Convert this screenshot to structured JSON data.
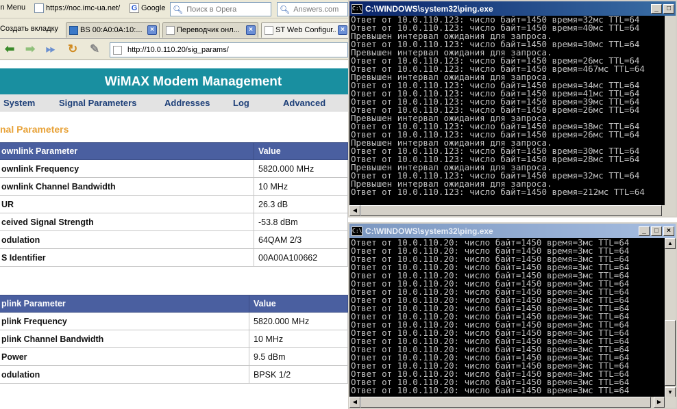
{
  "browser": {
    "bookmarks": [
      {
        "label": "in Menu",
        "icon": "page-icon"
      },
      {
        "label": "https://noc.imc-ua.net/",
        "icon": "page-icon"
      },
      {
        "label": "Google",
        "icon": "google-icon"
      }
    ],
    "search_opera": "Поиск в Opera",
    "search_answers": "Answers.com",
    "new_tab": "Создать вкладку",
    "tabs": [
      {
        "label": "BS 00:A0:0A:10:..."
      },
      {
        "label": "Переводчик онл..."
      },
      {
        "label": "ST Web Configur..."
      }
    ],
    "url": "http://10.0.110.20/sig_params/"
  },
  "page": {
    "banner": "WiMAX Modem Management",
    "menu": [
      "System",
      "Signal Parameters",
      "Addresses",
      "Log",
      "Advanced"
    ],
    "section_title": "nal Parameters",
    "downlink": {
      "headers": [
        "ownlink Parameter",
        "Value"
      ],
      "rows": [
        [
          "ownlink Frequency",
          "5820.000 MHz"
        ],
        [
          "ownlink Channel Bandwidth",
          "10 MHz"
        ],
        [
          "UR",
          "26.3 dB"
        ],
        [
          "ceived Signal Strength",
          "-53.8 dBm"
        ],
        [
          "odulation",
          "64QAM 2/3"
        ],
        [
          "S Identifier",
          "00A00A100662"
        ]
      ]
    },
    "uplink": {
      "headers": [
        "plink Parameter",
        "Value"
      ],
      "rows": [
        [
          "plink Frequency",
          "5820.000 MHz"
        ],
        [
          "plink Channel Bandwidth",
          "10 MHz"
        ],
        [
          "Power",
          "9.5 dBm"
        ],
        [
          "odulation",
          "BPSK 1/2"
        ]
      ]
    }
  },
  "console1": {
    "title": "C:\\WINDOWS\\system32\\ping.exe",
    "lines": [
      "Ответ от 10.0.110.123: число байт=1450 время=32мс TTL=64",
      "Ответ от 10.0.110.123: число байт=1450 время=40мс TTL=64",
      "Превышен интервал ожидания для запроса.",
      "Ответ от 10.0.110.123: число байт=1450 время=30мс TTL=64",
      "Превышен интервал ожидания для запроса.",
      "Ответ от 10.0.110.123: число байт=1450 время=26мс TTL=64",
      "Ответ от 10.0.110.123: число байт=1450 время=467мс TTL=64",
      "Превышен интервал ожидания для запроса.",
      "Ответ от 10.0.110.123: число байт=1450 время=34мс TTL=64",
      "Ответ от 10.0.110.123: число байт=1450 время=41мс TTL=64",
      "Ответ от 10.0.110.123: число байт=1450 время=39мс TTL=64",
      "Ответ от 10.0.110.123: число байт=1450 время=26мс TTL=64",
      "Превышен интервал ожидания для запроса.",
      "Ответ от 10.0.110.123: число байт=1450 время=38мс TTL=64",
      "Ответ от 10.0.110.123: число байт=1450 время=26мс TTL=64",
      "Превышен интервал ожидания для запроса.",
      "Ответ от 10.0.110.123: число байт=1450 время=30мс TTL=64",
      "Ответ от 10.0.110.123: число байт=1450 время=28мс TTL=64",
      "Превышен интервал ожидания для запроса.",
      "Ответ от 10.0.110.123: число байт=1450 время=32мс TTL=64",
      "Превышен интервал ожидания для запроса.",
      "Ответ от 10.0.110.123: число байт=1450 время=212мс TTL=64"
    ]
  },
  "console2": {
    "title": "C:\\WINDOWS\\system32\\ping.exe",
    "lines": [
      "Ответ от 10.0.110.20: число байт=1450 время=3мс TTL=64",
      "Ответ от 10.0.110.20: число байт=1450 время=3мс TTL=64",
      "Ответ от 10.0.110.20: число байт=1450 время=3мс TTL=64",
      "Ответ от 10.0.110.20: число байт=1450 время=3мс TTL=64",
      "Ответ от 10.0.110.20: число байт=1450 время=3мс TTL=64",
      "Ответ от 10.0.110.20: число байт=1450 время=3мс TTL=64",
      "Ответ от 10.0.110.20: число байт=1450 время=3мс TTL=64",
      "Ответ от 10.0.110.20: число байт=1450 время=3мс TTL=64",
      "Ответ от 10.0.110.20: число байт=1450 время=3мс TTL=64",
      "Ответ от 10.0.110.20: число байт=1450 время=3мс TTL=64",
      "Ответ от 10.0.110.20: число байт=1450 время=3мс TTL=64",
      "Ответ от 10.0.110.20: число байт=1450 время=3мс TTL=64",
      "Ответ от 10.0.110.20: число байт=1450 время=3мс TTL=64",
      "Ответ от 10.0.110.20: число байт=1450 время=3мс TTL=64",
      "Ответ от 10.0.110.20: число байт=1450 время=3мс TTL=64",
      "Ответ от 10.0.110.20: число байт=1450 время=3мс TTL=64",
      "Ответ от 10.0.110.20: число байт=1450 время=3мс TTL=64",
      "Ответ от 10.0.110.20: число байт=1450 время=3мс TTL=64",
      "Ответ от 10.0.110.20: число байт=1450 время=3мс TTL=64"
    ]
  },
  "colors": {
    "banner": "#198fa0",
    "table_header": "#4a5fa0",
    "section_title": "#e8a33a",
    "menu_link": "#1d3f78",
    "console_text": "#c0c0c0"
  }
}
